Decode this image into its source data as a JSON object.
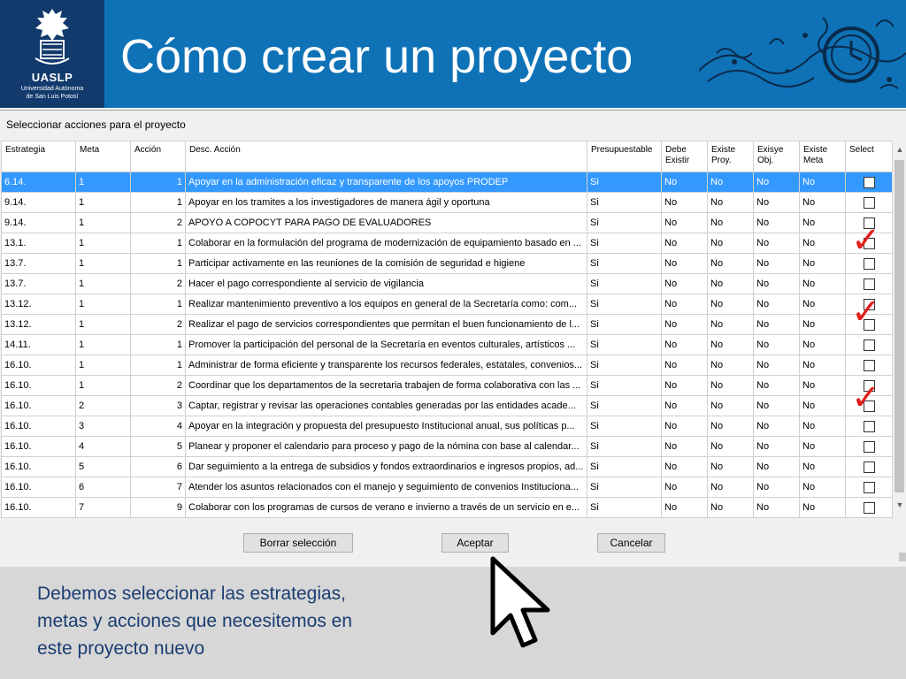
{
  "header": {
    "title": "Cómo crear un proyecto",
    "logo": {
      "name": "UASLP",
      "sub_line1": "Universidad Autónoma",
      "sub_line2": "de San Luis Potosí",
      "icon": "university-crest-icon"
    },
    "decoration_icon": "ornate-clock-icon"
  },
  "colors": {
    "header_bg": "#0f72b7",
    "logo_bg": "#123a6c",
    "selected_row": "#3399ff",
    "check_mark": "#e0201e",
    "note_text": "#1a3d72"
  },
  "dialog": {
    "title": "Seleccionar acciones para el proyecto",
    "columns": {
      "estrategia": "Estrategia",
      "meta": "Meta",
      "accion": "Acción",
      "desc": "Desc. Acción",
      "presupuestable": "Presupuestable",
      "debe_existir": "Debe Existir",
      "existe_proy": "Existe Proy.",
      "existe_obj": "Exisye Obj.",
      "existe_meta": "Existe Meta",
      "select": "Select"
    },
    "rows": [
      {
        "estrategia": "6.14.",
        "meta": "1",
        "accion": "1",
        "desc": "Apoyar en la administración eficaz y transparente de los apoyos PRODEP",
        "presupuestable": "Si",
        "debe_existir": "No",
        "existe_proy": "No",
        "existe_obj": "No",
        "existe_meta": "No"
      },
      {
        "estrategia": "9.14.",
        "meta": "1",
        "accion": "1",
        "desc": "Apoyar en los tramites a los investigadores de manera ágil y oportuna",
        "presupuestable": "Si",
        "debe_existir": "No",
        "existe_proy": "No",
        "existe_obj": "No",
        "existe_meta": "No"
      },
      {
        "estrategia": "9.14.",
        "meta": "1",
        "accion": "2",
        "desc": "APOYO A COPOCYT PARA PAGO DE EVALUADORES",
        "presupuestable": "Si",
        "debe_existir": "No",
        "existe_proy": "No",
        "existe_obj": "No",
        "existe_meta": "No"
      },
      {
        "estrategia": "13.1.",
        "meta": "1",
        "accion": "1",
        "desc": "Colaborar en la formulación del programa de modernización de equipamiento basado en ...",
        "presupuestable": "Si",
        "debe_existir": "No",
        "existe_proy": "No",
        "existe_obj": "No",
        "existe_meta": "No"
      },
      {
        "estrategia": "13.7.",
        "meta": "1",
        "accion": "1",
        "desc": "Participar activamente en las reuniones de la comisión de seguridad e higiene",
        "presupuestable": "Si",
        "debe_existir": "No",
        "existe_proy": "No",
        "existe_obj": "No",
        "existe_meta": "No"
      },
      {
        "estrategia": "13.7.",
        "meta": "1",
        "accion": "2",
        "desc": "Hacer el pago correspondiente al servicio de vigilancia",
        "presupuestable": "Si",
        "debe_existir": "No",
        "existe_proy": "No",
        "existe_obj": "No",
        "existe_meta": "No"
      },
      {
        "estrategia": "13.12.",
        "meta": "1",
        "accion": "1",
        "desc": "Realizar mantenimiento preventivo a los equipos en general de la Secretaría como: com...",
        "presupuestable": "Si",
        "debe_existir": "No",
        "existe_proy": "No",
        "existe_obj": "No",
        "existe_meta": "No"
      },
      {
        "estrategia": "13.12.",
        "meta": "1",
        "accion": "2",
        "desc": "Realizar el pago de servicios correspondientes que permitan el buen funcionamiento de l...",
        "presupuestable": "Si",
        "debe_existir": "No",
        "existe_proy": "No",
        "existe_obj": "No",
        "existe_meta": "No"
      },
      {
        "estrategia": "14.11.",
        "meta": "1",
        "accion": "1",
        "desc": "Promover la participación del personal de la Secretaría en eventos culturales, artísticos ...",
        "presupuestable": "Si",
        "debe_existir": "No",
        "existe_proy": "No",
        "existe_obj": "No",
        "existe_meta": "No"
      },
      {
        "estrategia": "16.10.",
        "meta": "1",
        "accion": "1",
        "desc": "Administrar de forma eficiente y transparente los recursos federales, estatales, convenios...",
        "presupuestable": "Si",
        "debe_existir": "No",
        "existe_proy": "No",
        "existe_obj": "No",
        "existe_meta": "No"
      },
      {
        "estrategia": "16.10.",
        "meta": "1",
        "accion": "2",
        "desc": "Coordinar que los departamentos de la secretaria trabajen de forma colaborativa con las ...",
        "presupuestable": "Si",
        "debe_existir": "No",
        "existe_proy": "No",
        "existe_obj": "No",
        "existe_meta": "No"
      },
      {
        "estrategia": "16.10.",
        "meta": "2",
        "accion": "3",
        "desc": "Captar, registrar y revisar las operaciones contables generadas por las entidades acade...",
        "presupuestable": "Si",
        "debe_existir": "No",
        "existe_proy": "No",
        "existe_obj": "No",
        "existe_meta": "No"
      },
      {
        "estrategia": "16.10.",
        "meta": "3",
        "accion": "4",
        "desc": "Apoyar en la integración y propuesta del presupuesto Institucional anual, sus políticas p...",
        "presupuestable": "Si",
        "debe_existir": "No",
        "existe_proy": "No",
        "existe_obj": "No",
        "existe_meta": "No"
      },
      {
        "estrategia": "16.10.",
        "meta": "4",
        "accion": "5",
        "desc": "Planear y proponer el calendario para proceso y pago de la nómina con base al calendar...",
        "presupuestable": "Si",
        "debe_existir": "No",
        "existe_proy": "No",
        "existe_obj": "No",
        "existe_meta": "No"
      },
      {
        "estrategia": "16.10.",
        "meta": "5",
        "accion": "6",
        "desc": "Dar seguimiento a la entrega de subsidios y fondos extraordinarios e ingresos propios, ad...",
        "presupuestable": "Si",
        "debe_existir": "No",
        "existe_proy": "No",
        "existe_obj": "No",
        "existe_meta": "No"
      },
      {
        "estrategia": "16.10.",
        "meta": "6",
        "accion": "7",
        "desc": "Atender los asuntos relacionados con el manejo y seguimiento de convenios Instituciona...",
        "presupuestable": "Si",
        "debe_existir": "No",
        "existe_proy": "No",
        "existe_obj": "No",
        "existe_meta": "No"
      },
      {
        "estrategia": "16.10.",
        "meta": "7",
        "accion": "9",
        "desc": "Colaborar con los programas de cursos de verano e invierno a través de un servicio en e...",
        "presupuestable": "Si",
        "debe_existir": "No",
        "existe_proy": "No",
        "existe_obj": "No",
        "existe_meta": "No"
      }
    ],
    "selected_row_index": 0,
    "annotated_check_rows": [
      3,
      7,
      11
    ],
    "buttons": {
      "clear": "Borrar selección",
      "accept": "Aceptar",
      "cancel": "Cancelar"
    }
  },
  "note": {
    "line1": "Debemos seleccionar las estrategias,",
    "line2": "metas y acciones que necesitemos en",
    "line3": "este proyecto nuevo"
  }
}
